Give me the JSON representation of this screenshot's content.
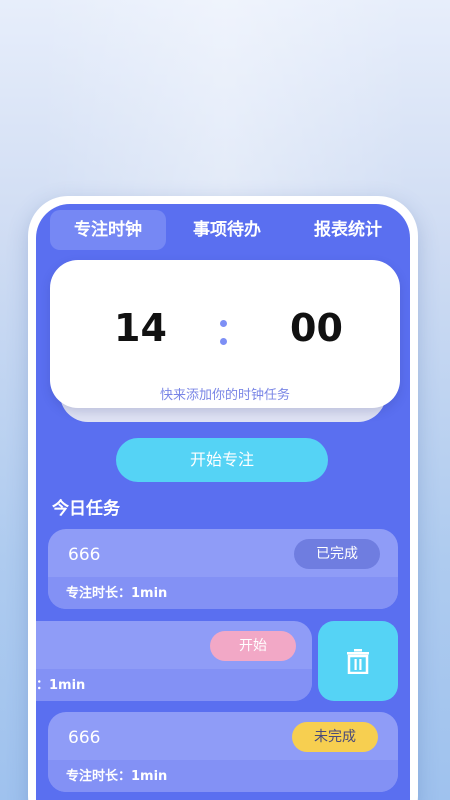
{
  "tabs": [
    {
      "label": "专注时钟",
      "active": true
    },
    {
      "label": "事项待办",
      "active": false
    },
    {
      "label": "报表统计",
      "active": false
    }
  ],
  "clock": {
    "hours": "14",
    "minutes": "00",
    "hint": "快来添加你的时钟任务"
  },
  "start_focus_label": "开始专注",
  "today_tasks_title": "今日任务",
  "tasks": [
    {
      "name": "666",
      "duration": "专注时长：1min",
      "status": "已完成"
    },
    {
      "name": "",
      "duration": "：1min",
      "status": "开始"
    },
    {
      "name": "666",
      "duration": "专注时长：1min",
      "status": "未完成"
    }
  ],
  "icons": {
    "delete": "trash-icon"
  },
  "colors": {
    "screen_bg": "#5a6ff0",
    "accent": "#55d3f5",
    "done_badge": "#6f7de0",
    "start_badge": "#f2a8c6",
    "pending_badge": "#f7cf50"
  }
}
